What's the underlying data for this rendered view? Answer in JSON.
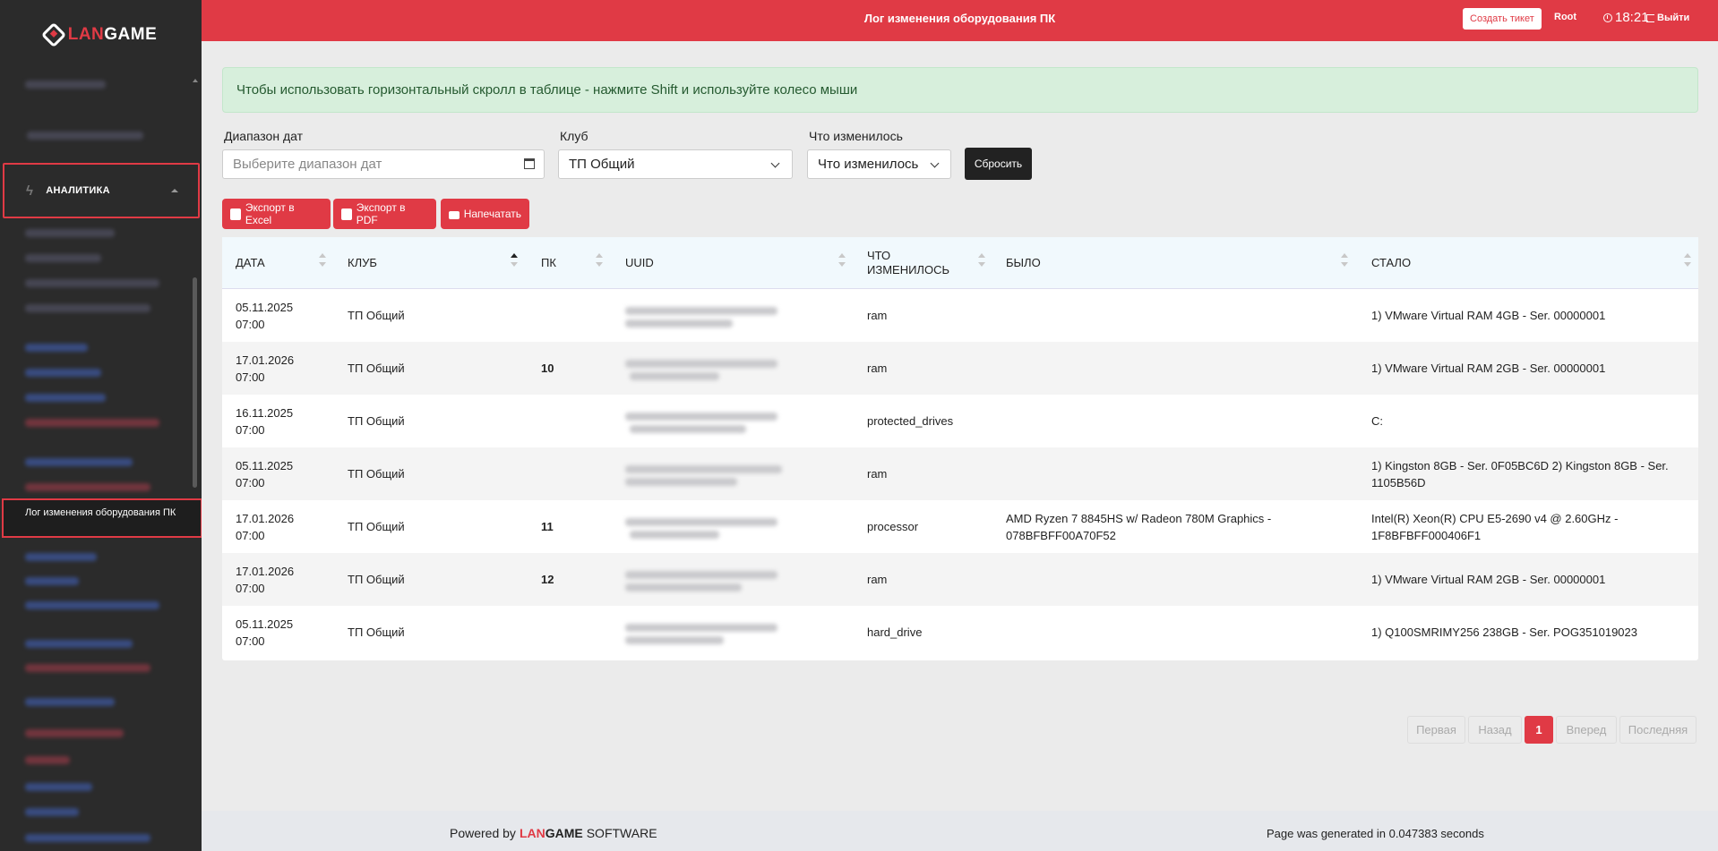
{
  "app": {
    "brand_prefix": "LAN",
    "brand_suffix": "GAME",
    "accent_color": "#e03a45"
  },
  "header": {
    "title": "Лог изменения оборудования ПК",
    "create_ticket": "Создать тикет",
    "user": "Root",
    "time": "18:21",
    "logout": "Выйти"
  },
  "sidebar": {
    "analytics_label": "АНАЛИТИКА",
    "active_item": "Лог изменения оборудования ПК"
  },
  "alert": {
    "text": "Чтобы использовать горизонтальный скролл в таблице - нажмите Shift и используйте колесо мыши"
  },
  "filters": {
    "date_label": "Диапазон дат",
    "date_placeholder": "Выберите диапазон дат",
    "club_label": "Клуб",
    "club_value": "ТП Общий",
    "changed_label": "Что изменилось",
    "changed_value": "Что изменилось",
    "reset": "Сбросить"
  },
  "actions": {
    "excel": "Экспорт в Excel",
    "pdf": "Экспорт в PDF",
    "print": "Напечатать"
  },
  "table": {
    "headers": {
      "date": "ДАТА",
      "club": "КЛУБ",
      "pc": "ПК",
      "uuid": "UUID",
      "changed_1": "ЧТО",
      "changed_2": "ИЗМЕНИЛОСЬ",
      "was": "БЫЛО",
      "became": "СТАЛО"
    },
    "rows": [
      {
        "date": "05.11.2025",
        "time": "07:00",
        "club": "ТП Общий",
        "pc": "",
        "what": "ram",
        "was": "",
        "became": "1) VMware Virtual RAM 4GB - Ser. 00000001"
      },
      {
        "date": "17.01.2026",
        "time": "07:00",
        "club": "ТП Общий",
        "pc": "10",
        "what": "ram",
        "was": "",
        "became": "1) VMware Virtual RAM 2GB - Ser. 00000001"
      },
      {
        "date": "16.11.2025",
        "time": "07:00",
        "club": "ТП Общий",
        "pc": "",
        "what": "protected_drives",
        "was": "",
        "became": "C:"
      },
      {
        "date": "05.11.2025",
        "time": "07:00",
        "club": "ТП Общий",
        "pc": "",
        "what": "ram",
        "was": "",
        "became": "1) Kingston 8GB - Ser. 0F05BC6D 2) Kingston 8GB - Ser. 1105B56D"
      },
      {
        "date": "17.01.2026",
        "time": "07:00",
        "club": "ТП Общий",
        "pc": "11",
        "what": "processor",
        "was": "AMD Ryzen 7 8845HS w/ Radeon 780M Graphics - 078BFBFF00A70F52",
        "became": "Intel(R) Xeon(R) CPU E5-2690 v4 @ 2.60GHz - 1F8BFBFF000406F1"
      },
      {
        "date": "17.01.2026",
        "time": "07:00",
        "club": "ТП Общий",
        "pc": "12",
        "what": "ram",
        "was": "",
        "became": "1) VMware Virtual RAM 2GB - Ser. 00000001"
      },
      {
        "date": "05.11.2025",
        "time": "07:00",
        "club": "ТП Общий",
        "pc": "",
        "what": "hard_drive",
        "was": "",
        "became": "1) Q100SMRIMY256 238GB - Ser. POG351019023"
      }
    ]
  },
  "pagination": {
    "first": "Первая",
    "prev": "Назад",
    "current": "1",
    "next": "Вперед",
    "last": "Последняя"
  },
  "footer": {
    "powered_by": "Powered by",
    "brand_prefix": "LAN",
    "brand_suffix": "GAME",
    "software": "SOFTWARE",
    "generated": "Page was generated in 0.047383 seconds"
  }
}
